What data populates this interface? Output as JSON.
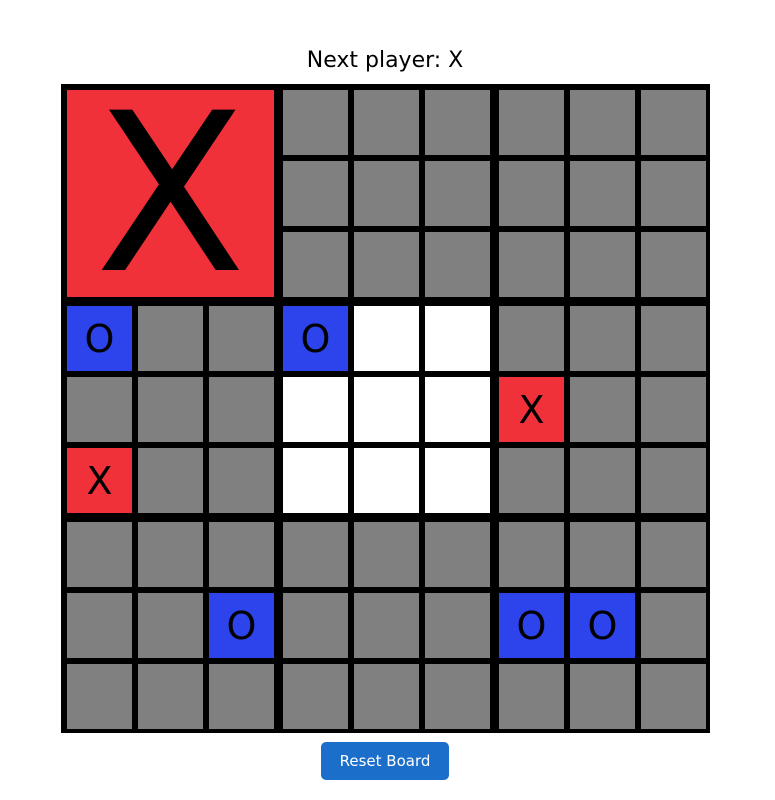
{
  "status": {
    "text": "Next player: X"
  },
  "colors": {
    "empty": "#808080",
    "active": "#ffffff",
    "x": "#f0313a",
    "o": "#2d43ec",
    "border": "#000000",
    "button": "#1b6ec9"
  },
  "board": {
    "active_subboard": 4,
    "subboards": [
      {
        "winner": "X",
        "cells": [
          "",
          "",
          "",
          "",
          "",
          "",
          "",
          "",
          ""
        ]
      },
      {
        "winner": "",
        "cells": [
          "",
          "",
          "",
          "",
          "",
          "",
          "",
          "",
          ""
        ]
      },
      {
        "winner": "",
        "cells": [
          "",
          "",
          "",
          "",
          "",
          "",
          "",
          "",
          ""
        ]
      },
      {
        "winner": "",
        "cells": [
          "O",
          "",
          "",
          "",
          "",
          "",
          "X",
          "",
          ""
        ]
      },
      {
        "winner": "",
        "cells": [
          "O",
          "",
          "",
          "",
          "",
          "",
          "",
          "",
          ""
        ]
      },
      {
        "winner": "",
        "cells": [
          "",
          "",
          "",
          "X",
          "",
          "",
          "",
          "",
          ""
        ]
      },
      {
        "winner": "",
        "cells": [
          "",
          "",
          "",
          "",
          "",
          "O",
          "",
          "",
          ""
        ]
      },
      {
        "winner": "",
        "cells": [
          "",
          "",
          "",
          "",
          "",
          "",
          "",
          "",
          ""
        ]
      },
      {
        "winner": "",
        "cells": [
          "",
          "",
          "",
          "O",
          "O",
          "",
          "",
          "",
          ""
        ]
      }
    ]
  },
  "controls": {
    "reset_label": "Reset Board"
  }
}
